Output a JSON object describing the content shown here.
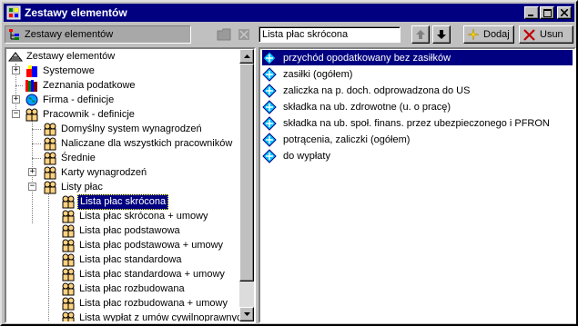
{
  "window": {
    "title": "Zestawy elementów"
  },
  "left_toolbar": {
    "label": "Zestawy elementów"
  },
  "tree": {
    "root": "Zestawy elementów",
    "items": [
      {
        "label": "Systemowe",
        "icon": "building-icon"
      },
      {
        "label": "Zeznania podatkowe",
        "icon": "books-icon"
      },
      {
        "label": "Firma - definicje",
        "icon": "globe-icon"
      },
      {
        "label": "Pracownik - definicje",
        "icon": "people-icon"
      },
      {
        "label": "Domyślny system wynagrodzeń",
        "icon": "people-icon"
      },
      {
        "label": "Naliczane dla wszystkich pracowników",
        "icon": "people-icon"
      },
      {
        "label": "Średnie",
        "icon": "people-icon"
      },
      {
        "label": "Karty wynagrodzeń",
        "icon": "people-icon"
      },
      {
        "label": "Listy płac",
        "icon": "people-icon"
      },
      {
        "label": "Lista płac skrócona",
        "icon": "people-icon"
      },
      {
        "label": "Lista płac skrócona + umowy",
        "icon": "people-icon"
      },
      {
        "label": "Lista płac podstawowa",
        "icon": "people-icon"
      },
      {
        "label": "Lista płac podstawowa + umowy",
        "icon": "people-icon"
      },
      {
        "label": "Lista płac standardowa",
        "icon": "people-icon"
      },
      {
        "label": "Lista płac standardowa + umowy",
        "icon": "people-icon"
      },
      {
        "label": "Lista płac rozbudowana",
        "icon": "people-icon"
      },
      {
        "label": "Lista płac rozbudowana + umowy",
        "icon": "people-icon"
      },
      {
        "label": "Lista wypłat z umów cywilnoprawnyc",
        "icon": "people-icon"
      }
    ]
  },
  "right_header": {
    "name_value": "Lista płac skrócona",
    "add_label": "Dodaj",
    "remove_label": "Usun"
  },
  "elements": [
    "przychód opodatkowany bez zasiłków",
    "zasiłki (ogółem)",
    "zaliczka na p. doch. odprowadzona do US",
    "składka na ub. zdrowotne (u. o pracę)",
    "składka na ub. społ. finans. przez ubezpieczonego i PFRON",
    "potrącenia, zaliczki (ogółem)",
    "do wypłaty"
  ],
  "colors": {
    "selection": "#000080",
    "face": "#c0c0c0"
  }
}
